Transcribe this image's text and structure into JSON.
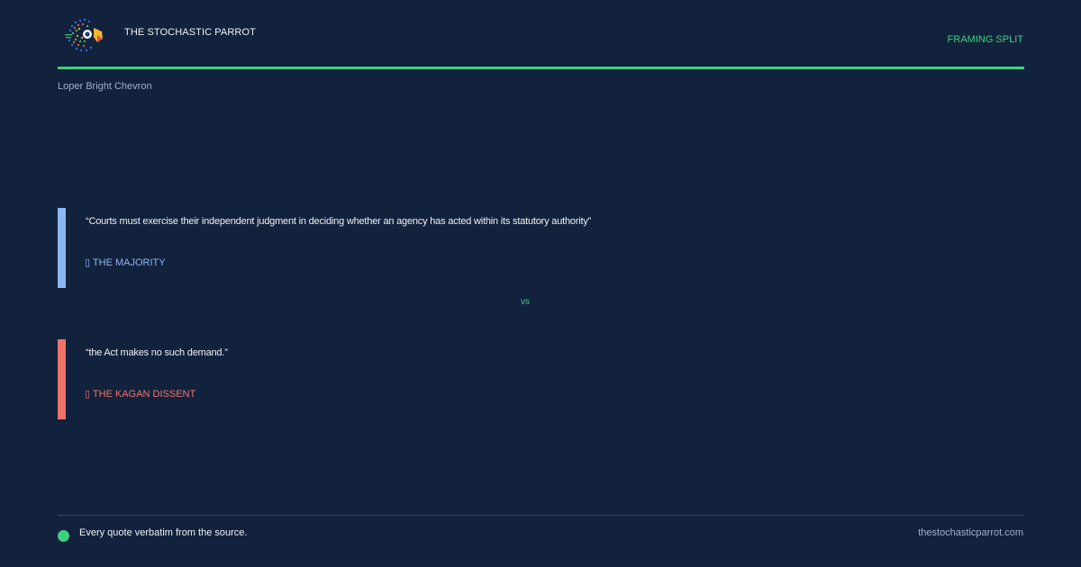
{
  "header": {
    "brand": "THE STOCHASTIC PARROT",
    "tag": "FRAMING SPLIT",
    "topic": "Loper Bright Chevron"
  },
  "quotes": [
    {
      "text": "“Courts must exercise their independent judgment in deciding whether an agency has acted within its statutory authority”",
      "attribution": "▯ THE MAJORITY",
      "color": "#8db6f5"
    },
    {
      "text": "“the Act makes no such demand.”",
      "attribution": "▯ THE KAGAN DISSENT",
      "color": "#f0736a"
    }
  ],
  "separator": "vs",
  "footer": {
    "note": "Every quote verbatim from the source.",
    "site": "thestochasticparrot.com"
  },
  "colors": {
    "background": "#12223c",
    "accent": "#3fd07f"
  },
  "icons": {
    "logo": "parrot-logo-icon",
    "footer_dot": "status-dot-icon"
  }
}
